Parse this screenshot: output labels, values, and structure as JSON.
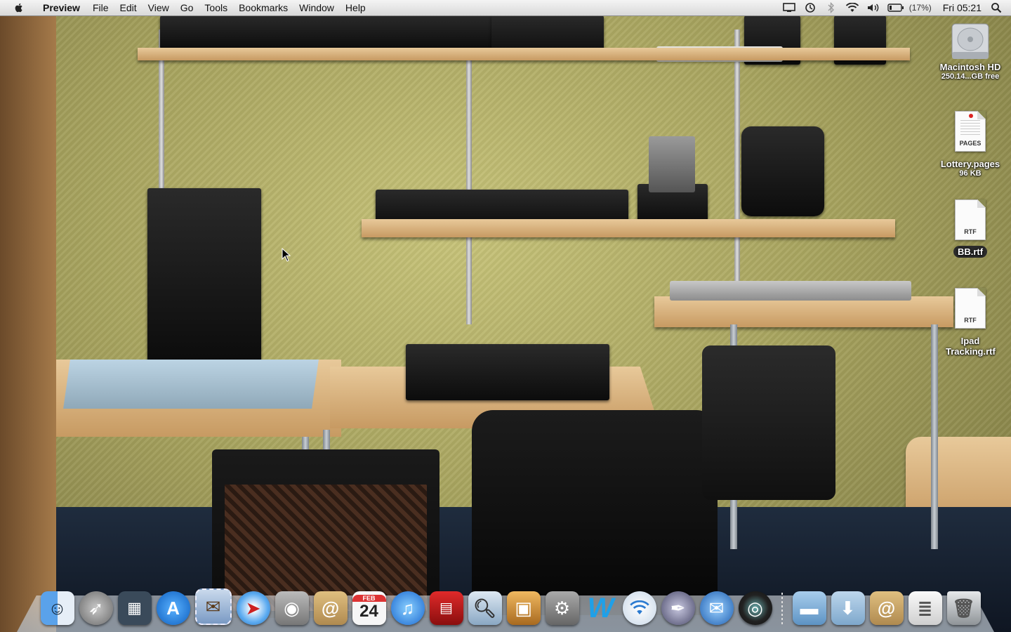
{
  "menubar": {
    "app_name": "Preview",
    "menus": [
      "File",
      "Edit",
      "View",
      "Go",
      "Tools",
      "Bookmarks",
      "Window",
      "Help"
    ],
    "status": {
      "battery_percent": "(17%)",
      "clock": "Fri 05:21",
      "icons": [
        "display-icon",
        "time-machine-icon",
        "bluetooth-icon",
        "wifi-icon",
        "volume-icon",
        "battery-icon",
        "spotlight-icon"
      ]
    }
  },
  "desktop": {
    "icons": [
      {
        "name": "Macintosh HD",
        "detail": "250.14...GB free",
        "kind": "hard-drive-icon"
      },
      {
        "name": "Lottery.pages",
        "detail": "96 KB",
        "kind": "pages-document-icon",
        "tag": "PAGES"
      },
      {
        "name": "BB.rtf",
        "detail": "",
        "kind": "rtf-document-icon",
        "tag": "RTF"
      },
      {
        "name": "Ipad Tracking.rtf",
        "detail": "",
        "kind": "rtf-document-icon",
        "tag": "RTF"
      }
    ]
  },
  "dock": {
    "apps": [
      {
        "id": "finder",
        "icon": "finder-icon",
        "color": "#4a8fd8"
      },
      {
        "id": "launchpad",
        "icon": "rocket-icon",
        "color": "#8d8d8d"
      },
      {
        "id": "mission-control",
        "icon": "mission-control-icon",
        "color": "#5a6a7a"
      },
      {
        "id": "app-store",
        "icon": "app-store-icon",
        "color": "#1e7fe0"
      },
      {
        "id": "mail-stamp",
        "icon": "mail-stamp-icon",
        "color": "#6d8fbf"
      },
      {
        "id": "safari",
        "icon": "compass-icon",
        "color": "#3b8de0"
      },
      {
        "id": "facetime",
        "icon": "camera-icon",
        "color": "#7a7a7a"
      },
      {
        "id": "address-book",
        "icon": "address-book-icon",
        "color": "#c8a160"
      },
      {
        "id": "ical",
        "icon": "calendar-icon",
        "color": "#f2f2f2",
        "month": "FEB",
        "day": "24"
      },
      {
        "id": "itunes",
        "icon": "music-note-icon",
        "color": "#2a7fe6"
      },
      {
        "id": "photo-booth",
        "icon": "photo-booth-icon",
        "color": "#c81e1e"
      },
      {
        "id": "preview",
        "icon": "preview-icon",
        "color": "#b0c8e0"
      },
      {
        "id": "iphoto",
        "icon": "iphoto-icon",
        "color": "#d9a24a"
      },
      {
        "id": "system-preferences",
        "icon": "gear-icon",
        "color": "#8a8a8a"
      },
      {
        "id": "w-app",
        "icon": "w-letter-icon",
        "color": "#1fa0e8",
        "letter": "W"
      },
      {
        "id": "wifi-app",
        "icon": "wifi-icon",
        "color": "#e8eef5"
      },
      {
        "id": "script-editor",
        "icon": "pen-icon",
        "color": "#6a6a8a"
      },
      {
        "id": "thunderbird",
        "icon": "thunderbird-icon",
        "color": "#2f6fc2"
      },
      {
        "id": "aperture",
        "icon": "lens-icon",
        "color": "#333333"
      }
    ],
    "others": [
      {
        "id": "applications-folder",
        "icon": "folder-icon",
        "color": "#7fb0d8"
      },
      {
        "id": "downloads-folder",
        "icon": "downloads-folder-icon",
        "color": "#9cc0dc"
      },
      {
        "id": "contacts-stack",
        "icon": "contacts-stack-icon",
        "color": "#c8a160"
      },
      {
        "id": "documents-stack",
        "icon": "documents-stack-icon",
        "color": "#e8e8e8"
      },
      {
        "id": "trash",
        "icon": "trash-icon",
        "color": "#b8bcc0"
      }
    ]
  }
}
